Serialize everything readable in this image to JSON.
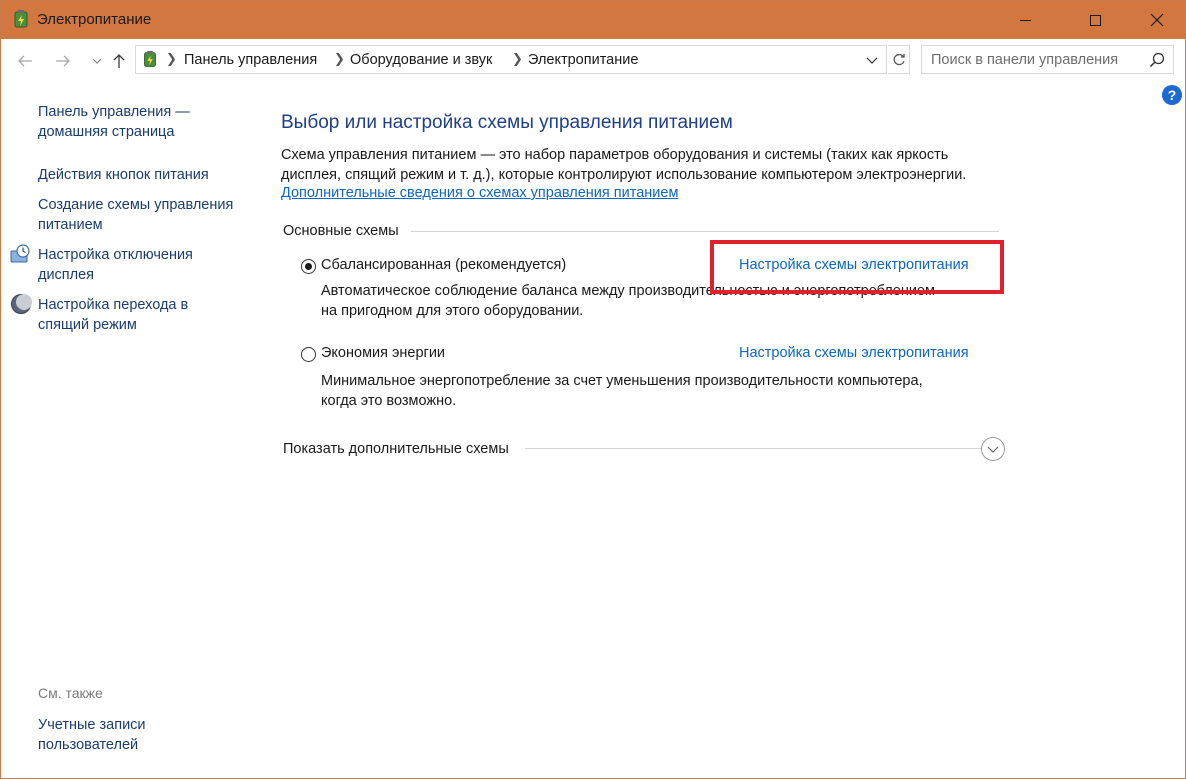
{
  "window": {
    "title": "Электропитание",
    "accent_color": "#d2773f",
    "icon": "power-options-icon"
  },
  "nav": {
    "back_icon": "arrow-left-icon",
    "forward_icon": "arrow-right-icon",
    "recent_icon": "chevron-down-icon",
    "up_icon": "arrow-up-icon"
  },
  "address": {
    "crumbs": [
      "Панель управления",
      "Оборудование и звук",
      "Электропитание"
    ]
  },
  "search": {
    "placeholder": "Поиск в панели управления"
  },
  "help": {
    "label": "?"
  },
  "sidebar": {
    "home_link": [
      "Панель управления —",
      "домашняя страница"
    ],
    "items": [
      {
        "lines": [
          "Действия кнопок питания"
        ],
        "icon": null
      },
      {
        "lines": [
          "Создание схемы управления",
          "питанием"
        ],
        "icon": null
      },
      {
        "lines": [
          "Настройка отключения",
          "дисплея"
        ],
        "icon": "display-clock-icon"
      },
      {
        "lines": [
          "Настройка перехода в",
          "спящий режим"
        ],
        "icon": "moon-icon"
      }
    ],
    "see_also_label": "См. также",
    "see_also_link": [
      "Учетные записи",
      "пользователей"
    ]
  },
  "main": {
    "title": "Выбор или настройка схемы управления питанием",
    "description": [
      "Схема управления питанием — это набор параметров оборудования и системы (таких как яркость",
      "дисплея, спящий режим и т. д.), которые контролируют использование компьютером электроэнергии."
    ],
    "more_info_link": "Дополнительные сведения о схемах управления питанием",
    "group_label": "Основные схемы",
    "plans": [
      {
        "name": "Сбалансированная (рекомендуется)",
        "selected": true,
        "link": "Настройка схемы электропитания",
        "description": [
          "Автоматическое соблюдение баланса между производительностью и энергопотреблением",
          "на пригодном для этого оборудовании."
        ]
      },
      {
        "name": "Экономия энергии",
        "selected": false,
        "link": "Настройка схемы электропитания",
        "description": [
          "Минимальное энергопотребление за счет уменьшения производительности компьютера,",
          "когда это возможно."
        ]
      }
    ],
    "show_more_label": "Показать дополнительные схемы",
    "highlight_color": "#e0202a"
  }
}
